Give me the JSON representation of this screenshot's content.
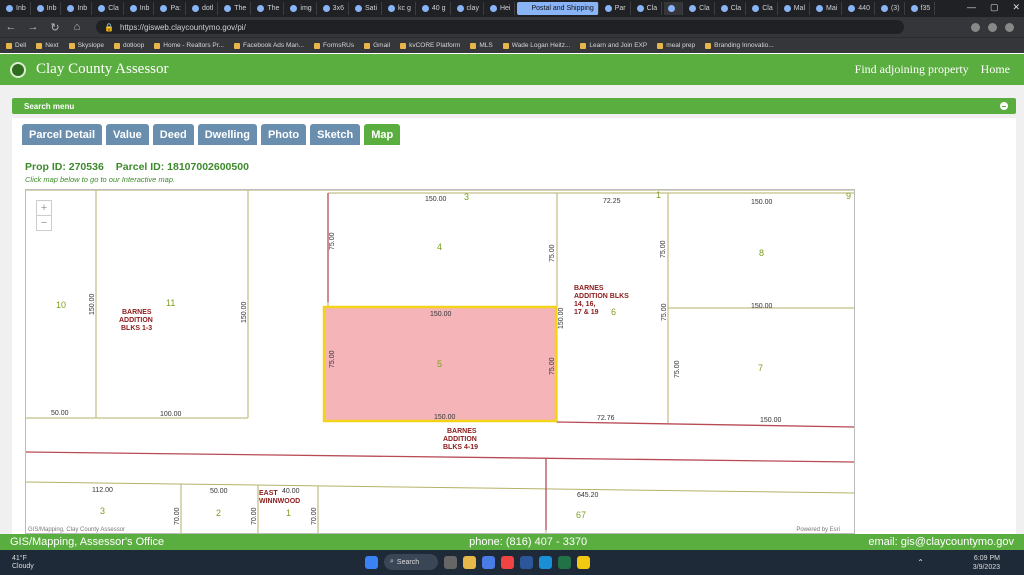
{
  "browser": {
    "tabs": [
      {
        "label": "Inb"
      },
      {
        "label": "Inb"
      },
      {
        "label": "Inb"
      },
      {
        "label": "Cla"
      },
      {
        "label": "Inb"
      },
      {
        "label": "Pa:"
      },
      {
        "label": "dotl"
      },
      {
        "label": "The"
      },
      {
        "label": "The"
      },
      {
        "label": "img"
      },
      {
        "label": "3x6"
      },
      {
        "label": "Sati"
      },
      {
        "label": "kc g"
      },
      {
        "label": "40 g"
      },
      {
        "label": "clay"
      },
      {
        "label": "Hei"
      },
      {
        "label": "Postal and Shipping",
        "highlight": true
      },
      {
        "label": "Par"
      },
      {
        "label": "Cla"
      },
      {
        "label": "",
        "active": true
      },
      {
        "label": "Cla"
      },
      {
        "label": "Cla"
      },
      {
        "label": "Cla"
      },
      {
        "label": "Mal"
      },
      {
        "label": "Mai"
      },
      {
        "label": "440"
      },
      {
        "label": "(3)"
      },
      {
        "label": "f35"
      }
    ],
    "window_controls": [
      "—",
      "▢",
      "✕"
    ],
    "url": "https://gisweb.claycountymo.gov/pi/",
    "bookmarks": [
      "Dell",
      "Next",
      "Skyslope",
      "dotloop",
      "Home - Realtors Pr...",
      "Facebook Ads Man...",
      "FormsRUs",
      "Gmail",
      "kvCORE Platform",
      "MLS",
      "Wade Logan Heitz...",
      "Learn and Join EXP",
      "meal prep",
      "Branding Innovatio..."
    ]
  },
  "header": {
    "title": "Clay County Assessor",
    "links": [
      "Find adjoining property",
      "Home"
    ]
  },
  "search_menu": {
    "label": "Search menu"
  },
  "parcel_tabs": [
    {
      "label": "Parcel Detail"
    },
    {
      "label": "Value"
    },
    {
      "label": "Deed"
    },
    {
      "label": "Dwelling"
    },
    {
      "label": "Photo"
    },
    {
      "label": "Sketch"
    },
    {
      "label": "Map",
      "active": true
    }
  ],
  "parcel": {
    "prop_id": "Prop ID: 270536",
    "parcel_id": "Parcel ID: 18107002600500",
    "hint": "Click map below to go to our Interactive map."
  },
  "map": {
    "zoom_in": "+",
    "zoom_out": "−",
    "credit_left": "GIS/Mapping, Clay County Assessor",
    "credit_right": "Powered by Esri",
    "lot_numbers": [
      "3",
      "1",
      "9",
      "4",
      "8",
      "10",
      "11",
      "6",
      "5",
      "7",
      "3",
      "2",
      "1",
      "67"
    ],
    "dimensions": [
      "150.00",
      "72.25",
      "150.00",
      "75.00",
      "75.00",
      "150.00",
      "150.00",
      "150.00",
      "150.00",
      "75.00",
      "75.00",
      "75.00",
      "150.00",
      "50.00",
      "100.00",
      "150.00",
      "72.76",
      "150.00",
      "112.00",
      "50.00",
      "40.00",
      "645.20",
      "70.00",
      "70.00",
      "70.00"
    ],
    "subdivisions": [
      "BARNES ADDITION BLKS 1-3",
      "BARNES ADDITION BLKS 14, 16, 17 & 19",
      "BARNES ADDITION BLKS 4-19",
      "EAST WINNWOOD"
    ],
    "highlight_color": "#f5b5b8",
    "highlight_border": "#f2d21a"
  },
  "footer": {
    "left": "GIS/Mapping, Assessor's Office",
    "phone": "phone: (816) 407 - 3370",
    "email": "email: gis@claycountymo.gov"
  },
  "taskbar": {
    "temp": "41°F",
    "condition": "Cloudy",
    "search": "Search",
    "time": "6:09 PM",
    "date": "3/9/2023"
  }
}
